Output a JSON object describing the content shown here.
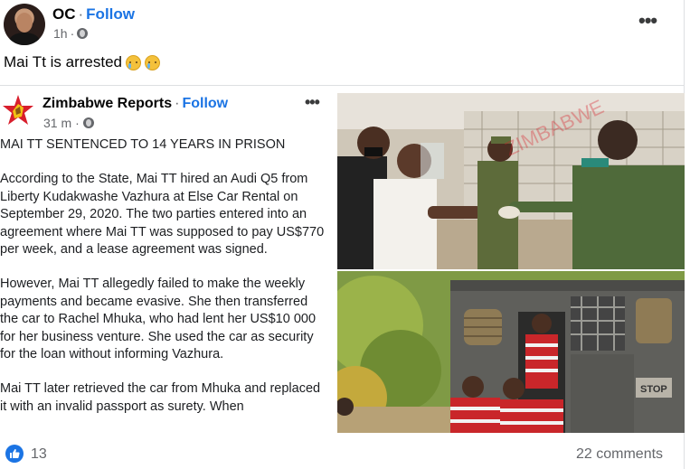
{
  "post": {
    "author": "OC",
    "separator": "·",
    "follow_label": "Follow",
    "time": "1h",
    "privacy_icon": "globe-icon",
    "caption": "Mai Tt is arrested",
    "emoji_icon": "crying-face-icon"
  },
  "shared": {
    "page_name": "Zimbabwe Reports",
    "separator": "·",
    "follow_label": "Follow",
    "time": "31 m",
    "privacy_icon": "globe-icon",
    "paragraphs": [
      "MAI TT SENTENCED TO 14 YEARS IN PRISON",
      "According to the State, Mai TT hired an Audi Q5 from Liberty Kudakwashe Vazhura at Else Car Rental on September 29, 2020. The two parties entered into an agreement where Mai TT was supposed to pay US$770 per week, and a lease agreement was signed.",
      "However, Mai TT allegedly failed to make the weekly payments and became evasive. She then transferred the car to Rachel Mhuka, who had lent her US$10 000 for her business venture. She used the car as security for the loan without informing Vazhura.",
      "Mai TT later retrieved the car from Mhuka and replaced it with an invalid passport as surety. When"
    ],
    "truck_sign": "STOP"
  },
  "footer": {
    "reaction_icon": "like-icon",
    "reaction_count": "13",
    "comments": "22 comments"
  },
  "colors": {
    "link_blue": "#1b74e4",
    "secondary_text": "#65676b"
  }
}
